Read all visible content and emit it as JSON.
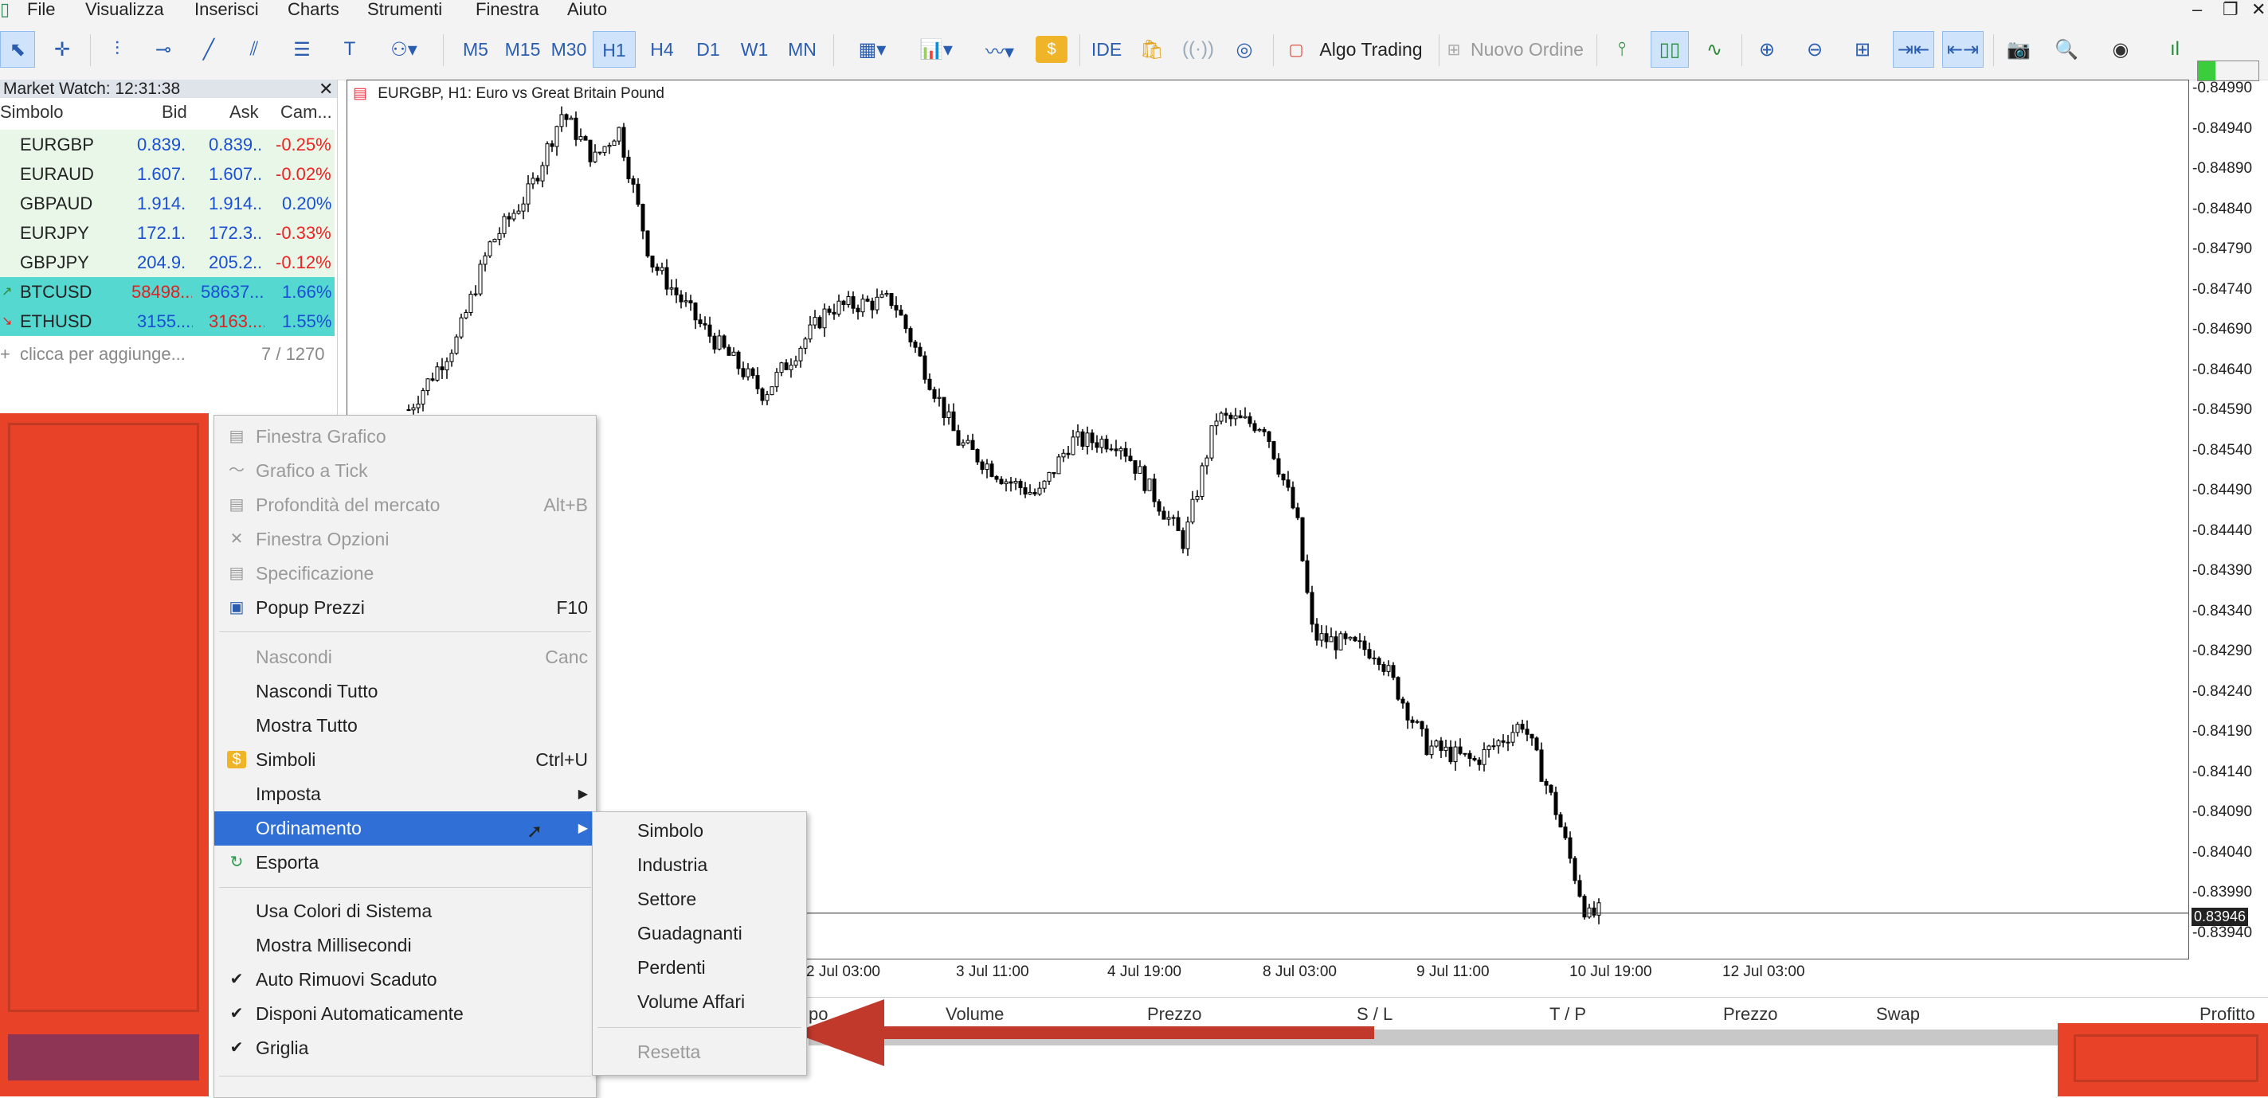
{
  "menubar": {
    "items": [
      "File",
      "Visualizza",
      "Inserisci",
      "Charts",
      "Strumenti",
      "Finestra",
      "Aiuto"
    ]
  },
  "toolbar": {
    "timeframes": [
      "M5",
      "M15",
      "M30",
      "H1",
      "H4",
      "D1",
      "W1",
      "MN"
    ],
    "selected_timeframe": "H1",
    "ide": "IDE",
    "algo_trading": "Algo Trading",
    "new_order": "Nuovo Ordine"
  },
  "market_watch": {
    "title": "Market Watch: 12:31:38",
    "columns": [
      "Simbolo",
      "Bid",
      "Ask",
      "Cam..."
    ],
    "rows": [
      {
        "symbol": "EURGBP",
        "bid": "0.839...",
        "ask": "0.839...",
        "change": "-0.25%"
      },
      {
        "symbol": "EURAUD",
        "bid": "1.607...",
        "ask": "1.607...",
        "change": "-0.02%"
      },
      {
        "symbol": "GBPAUD",
        "bid": "1.914...",
        "ask": "1.914...",
        "change": "0.20%"
      },
      {
        "symbol": "EURJPY",
        "bid": "172.1...",
        "ask": "172.3...",
        "change": "-0.33%"
      },
      {
        "symbol": "GBPJPY",
        "bid": "204.9...",
        "ask": "205.2...",
        "change": "-0.12%"
      },
      {
        "symbol": "BTCUSD",
        "bid": "58498...",
        "ask": "58637...",
        "change": "1.66%"
      },
      {
        "symbol": "ETHUSD",
        "bid": "3155....",
        "ask": "3163....",
        "change": "1.55%"
      }
    ],
    "add_hint": "clicca per aggiunge...",
    "count": "7 / 1270"
  },
  "chart": {
    "title": "EURGBP, H1:  Euro vs Great Britain Pound",
    "current_price": "0.83946",
    "price_labels": [
      "0.84990",
      "0.84940",
      "0.84890",
      "0.84840",
      "0.84790",
      "0.84740",
      "0.84690",
      "0.84640",
      "0.84590",
      "0.84540",
      "0.84490",
      "0.84440",
      "0.84390",
      "0.84340",
      "0.84290",
      "0.84240",
      "0.84190",
      "0.84140",
      "0.84090",
      "0.84040",
      "0.83990",
      "0.83940"
    ],
    "date_labels": [
      "2 Jul 03:00",
      "3 Jul 11:00",
      "4 Jul 19:00",
      "8 Jul 03:00",
      "9 Jul 11:00",
      "10 Jul 19:00",
      "12 Jul 03:00"
    ]
  },
  "context_menu": {
    "items": [
      {
        "label": "Finestra Grafico",
        "shortcut": "",
        "disabled": true,
        "icon": "chart-window-icon"
      },
      {
        "label": "Grafico a Tick",
        "shortcut": "",
        "disabled": true,
        "icon": "tick-chart-icon"
      },
      {
        "label": "Profondità del mercato",
        "shortcut": "Alt+B",
        "disabled": true,
        "icon": "market-depth-icon"
      },
      {
        "label": "Finestra Opzioni",
        "shortcut": "",
        "disabled": true,
        "icon": "options-icon"
      },
      {
        "label": "Specificazione",
        "shortcut": "",
        "disabled": true,
        "icon": "specification-icon"
      },
      {
        "label": "Popup Prezzi",
        "shortcut": "F10",
        "disabled": false,
        "icon": "popup-prices-icon"
      },
      {
        "label": "Nascondi",
        "shortcut": "Canc",
        "disabled": true
      },
      {
        "label": "Nascondi Tutto",
        "shortcut": "",
        "disabled": false
      },
      {
        "label": "Mostra Tutto",
        "shortcut": "",
        "disabled": false
      },
      {
        "label": "Simboli",
        "shortcut": "Ctrl+U",
        "disabled": false,
        "icon": "symbols-icon"
      },
      {
        "label": "Imposta",
        "shortcut": "",
        "disabled": false,
        "submenu": true
      },
      {
        "label": "Ordinamento",
        "shortcut": "",
        "disabled": false,
        "submenu": true,
        "highlighted": true
      },
      {
        "label": "Esporta",
        "shortcut": "",
        "disabled": false,
        "icon": "export-icon"
      },
      {
        "label": "Usa Colori di Sistema",
        "shortcut": "",
        "disabled": false
      },
      {
        "label": "Mostra Millisecondi",
        "shortcut": "",
        "disabled": false
      },
      {
        "label": "Auto Rimuovi Scaduto",
        "shortcut": "",
        "disabled": false,
        "checked": true
      },
      {
        "label": "Disponi Automaticamente",
        "shortcut": "",
        "disabled": false,
        "checked": true
      },
      {
        "label": "Griglia",
        "shortcut": "",
        "disabled": false,
        "checked": true
      }
    ]
  },
  "submenu": {
    "items": [
      "Simbolo",
      "Industria",
      "Settore",
      "Guadagnanti",
      "Perdenti",
      "Volume Affari"
    ],
    "reset": "Resetta"
  },
  "bottom_table": {
    "columns": [
      "po",
      "Volume",
      "Prezzo",
      "S / L",
      "T / P",
      "Prezzo",
      "Swap",
      "Profitto"
    ]
  },
  "colors": {
    "accent": "#2f6fd6",
    "annotation_red": "#e84329",
    "arrow_red": "#c0392b",
    "cyan_row": "#54d8d0",
    "green_row": "#e9f7e9"
  }
}
